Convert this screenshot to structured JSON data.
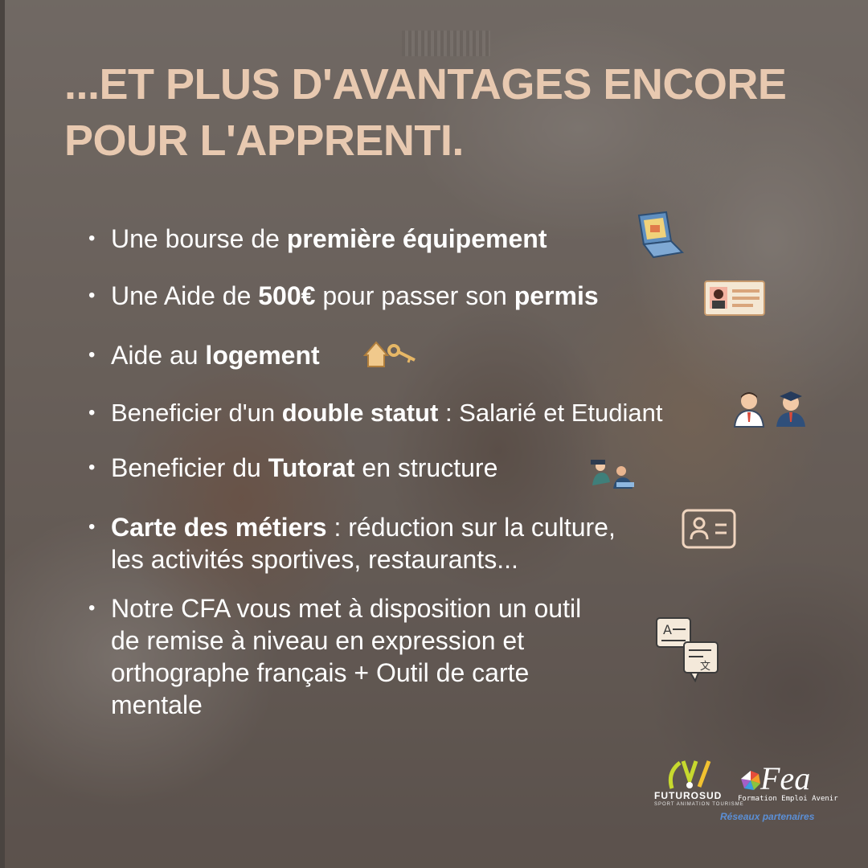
{
  "title": {
    "line1": "...ET PLUS D'AVANTAGES ENCORE",
    "line2": "POUR L'APPRENTI."
  },
  "benefits": [
    {
      "pre": "Une bourse de ",
      "bold1": "première équipement",
      "post": "",
      "icon": "laptop-icon"
    },
    {
      "pre": "Une Aide de ",
      "bold1": "500€",
      "mid": " pour passer son ",
      "bold2": "permis",
      "icon": "id-card-icon"
    },
    {
      "pre": "Aide au ",
      "bold1": "logement",
      "icon": "house-key-icon"
    },
    {
      "pre": "Beneficier d'un ",
      "bold1": "double statut",
      "post": " : Salarié et Etudiant",
      "icon": "employee-student-icon"
    },
    {
      "pre": "Beneficier du ",
      "bold1": "Tutorat",
      "post": " en structure",
      "icon": "tutoring-icon"
    },
    {
      "bold1": "Carte des métiers",
      "post": " : réduction sur la culture,",
      "line2": "les activités sportives, restaurants...",
      "icon": "member-card-icon"
    },
    {
      "line1": "Notre CFA vous met à disposition un outil",
      "line2": "de remise à niveau en expression et",
      "line3": "orthographe français + Outil de carte",
      "line4": "mentale",
      "icon": "translate-icon"
    }
  ],
  "logos": {
    "futuro_name": "FUTUROSUD",
    "futuro_tagline": "SPORT ANIMATION TOURISME",
    "fea_name": "Fea",
    "fea_tagline": "Formation Emploi Avenir",
    "partners_label": "Réseaux partenaires"
  },
  "colors": {
    "title": "#e8c9b0",
    "text": "#ffffff",
    "partners": "#5b8fd6"
  }
}
